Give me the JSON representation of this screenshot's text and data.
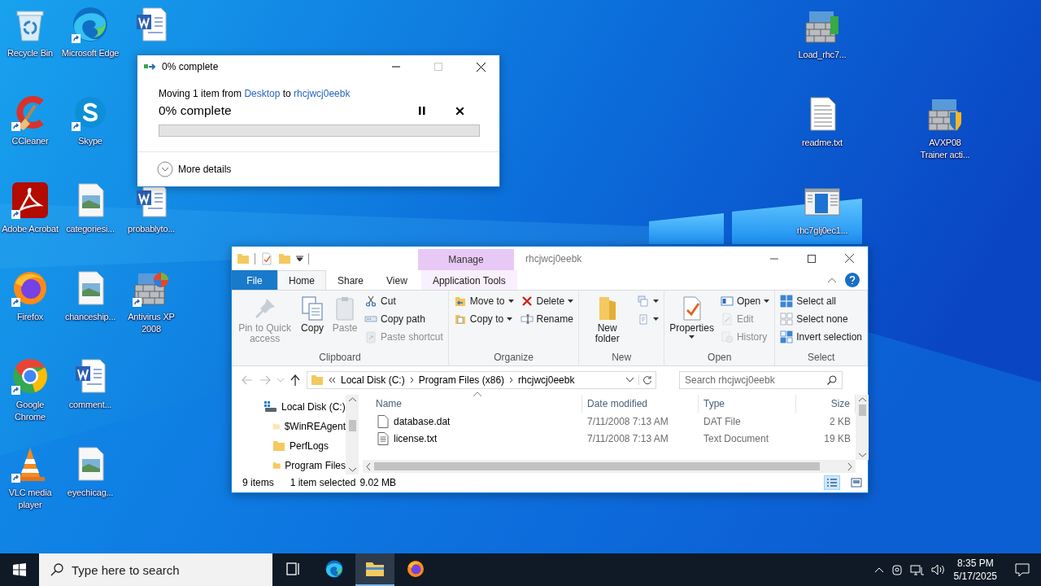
{
  "desktop": {
    "left_columns": [
      [
        {
          "label": "Recycle Bin",
          "kind": "recycle-bin",
          "shortcut": false
        },
        {
          "label": "CCleaner",
          "kind": "ccleaner",
          "shortcut": true
        },
        {
          "label": "Adobe Acrobat",
          "kind": "acrobat",
          "shortcut": true
        },
        {
          "label": "Firefox",
          "kind": "firefox",
          "shortcut": true
        },
        {
          "label": "Google Chrome",
          "kind": "chrome",
          "shortcut": true
        },
        {
          "label": "VLC media player",
          "kind": "vlc",
          "shortcut": true
        }
      ],
      [
        {
          "label": "Microsoft Edge",
          "kind": "edge",
          "shortcut": true
        },
        {
          "label": "Skype",
          "kind": "skype",
          "shortcut": true
        },
        {
          "label": "categoriesi...",
          "kind": "image",
          "shortcut": false
        },
        {
          "label": "chanceship...",
          "kind": "image",
          "shortcut": false
        },
        {
          "label": "comment...",
          "kind": "word",
          "shortcut": false
        },
        {
          "label": "eyechicag...",
          "kind": "image",
          "shortcut": false
        }
      ],
      [
        {
          "kind": "word",
          "shortcut": false
        },
        null,
        {
          "label": "probablyto...",
          "kind": "word",
          "shortcut": false
        },
        {
          "label": "Antivirus XP 2008",
          "kind": "wall",
          "shortcut": true
        }
      ]
    ],
    "right_columns": [
      [
        {
          "label": "Load_rhc7...",
          "kind": "wall-monitor",
          "shortcut": false
        },
        {
          "label": "readme.txt",
          "kind": "text",
          "shortcut": false
        },
        {
          "label": "rhc7glj0ec1...",
          "kind": "window",
          "shortcut": false
        }
      ],
      [
        null,
        {
          "label": "AVXP08 Trainer acti...",
          "kind": "wall-shield",
          "shortcut": false
        }
      ]
    ]
  },
  "progress_dialog": {
    "title": "0% complete",
    "maximize_disabled": true,
    "message": {
      "prefix": "Moving 1 item from",
      "source": "Desktop",
      "middle": "to",
      "destination": "rhcjwcj0eebk"
    },
    "status": "0% complete",
    "level": 0,
    "details": {
      "label": "More details",
      "expanded": false
    }
  },
  "explorer": {
    "context_label": "Manage",
    "title": "rhcjwcj0eebk",
    "tabs": [
      {
        "label": "File",
        "kind": "file",
        "selected": false
      },
      {
        "label": "Home",
        "kind": "tab",
        "selected": true
      },
      {
        "label": "Share",
        "kind": "tab",
        "selected": false
      },
      {
        "label": "View",
        "kind": "tab",
        "selected": false
      },
      {
        "label": "Application Tools",
        "kind": "context",
        "selected": false
      }
    ],
    "ribbon": [
      {
        "label": "Clipboard",
        "columns": [
          [
            {
              "label": "Pin to Quick access",
              "kind": "pin",
              "disabled": true,
              "menu": false
            }
          ],
          [
            {
              "label": "Copy",
              "kind": "copy",
              "disabled": false,
              "menu": false
            }
          ],
          [
            {
              "label": "Paste",
              "kind": "paste",
              "disabled": true,
              "menu": false
            }
          ],
          [
            {
              "label": "Cut",
              "kind": "cut",
              "disabled": false,
              "menu": false
            },
            {
              "label": "Copy path",
              "kind": "copy-path",
              "disabled": false,
              "menu": false
            },
            {
              "label": "Paste shortcut",
              "kind": "paste-shortcut",
              "disabled": true,
              "menu": false
            }
          ]
        ]
      },
      {
        "label": "Organize",
        "columns": [
          [
            {
              "label": "Move to",
              "kind": "move-to",
              "disabled": false,
              "menu": true
            },
            {
              "label": "Copy to",
              "kind": "copy-to",
              "disabled": false,
              "menu": true
            }
          ],
          [
            {
              "label": "Delete",
              "kind": "delete",
              "disabled": false,
              "menu": true
            },
            {
              "label": "Rename",
              "kind": "rename",
              "disabled": false,
              "menu": false
            }
          ]
        ]
      },
      {
        "label": "New",
        "columns": [
          [
            {
              "label": "New folder",
              "kind": "new-folder",
              "disabled": false,
              "menu": false
            }
          ],
          [
            {
              "kind": "new-item",
              "disabled": false,
              "menu": true
            },
            {
              "kind": "easy-access",
              "disabled": false,
              "menu": true
            }
          ]
        ]
      },
      {
        "label": "Open",
        "columns": [
          [
            {
              "label": "Properties",
              "kind": "properties",
              "disabled": false,
              "menu": true
            }
          ],
          [
            {
              "label": "Open",
              "kind": "open",
              "disabled": false,
              "menu": true
            },
            {
              "label": "Edit",
              "kind": "edit",
              "disabled": true,
              "menu": false
            },
            {
              "label": "History",
              "kind": "history",
              "disabled": true,
              "menu": false
            }
          ]
        ]
      },
      {
        "label": "Select",
        "columns": [
          [
            {
              "label": "Select all",
              "kind": "select-all",
              "disabled": false,
              "menu": false
            },
            {
              "label": "Select none",
              "kind": "select-none",
              "disabled": false,
              "menu": false
            },
            {
              "label": "Invert selection",
              "kind": "invert-selection",
              "disabled": false,
              "menu": false
            }
          ]
        ]
      }
    ],
    "address": [
      "Local Disk (C:)",
      "Program Files (x86)",
      "rhcjwcj0eebk"
    ],
    "search_placeholder": "Search rhcjwcj0eebk",
    "navigation": [
      {
        "label": "Local Disk (C:)",
        "kind": "drive",
        "children": [
          {
            "label": "$WinREAgent",
            "kind": "hidden-folder"
          },
          {
            "label": "PerfLogs",
            "kind": "folder"
          },
          {
            "label": "Program Files",
            "kind": "folder"
          }
        ]
      }
    ],
    "columns": [
      "Name",
      "Date modified",
      "Type",
      "Size"
    ],
    "files": [
      {
        "name": "database.dat",
        "date": "7/11/2008 7:13 AM",
        "type": "DAT File",
        "size": "2 KB",
        "kind": "blank",
        "selected": false
      },
      {
        "name": "license.txt",
        "date": "7/11/2008 7:13 AM",
        "type": "Text Document",
        "size": "19 KB",
        "kind": "text",
        "selected": false
      }
    ],
    "status": {
      "count": "9 items",
      "selection": "1 item selected",
      "size": "9.02 MB"
    },
    "views": [
      {
        "kind": "details",
        "selected": true
      },
      {
        "kind": "tiles",
        "selected": false
      }
    ]
  },
  "taskbar": {
    "search_placeholder": "Type here to search",
    "apps": [
      {
        "kind": "task-view",
        "active": false
      },
      {
        "kind": "edge",
        "active": false
      },
      {
        "kind": "explorer",
        "active": true
      },
      {
        "kind": "firefox",
        "active": false
      }
    ],
    "time": "8:35 PM",
    "date": "5/17/2025"
  }
}
